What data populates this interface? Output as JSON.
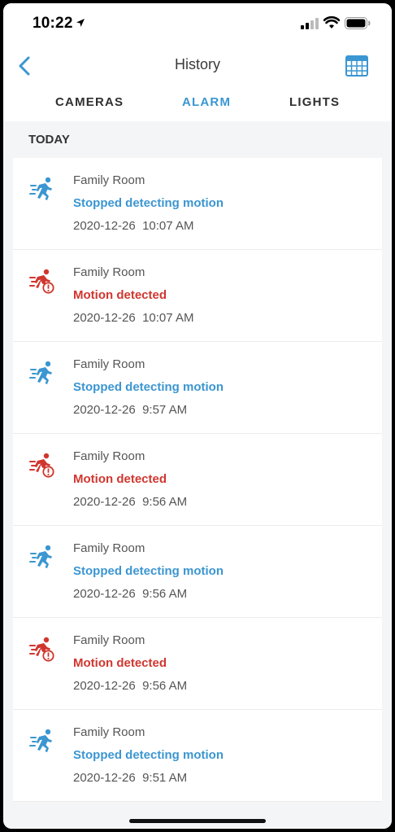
{
  "status_bar": {
    "time": "10:22"
  },
  "header": {
    "title": "History"
  },
  "tabs": [
    {
      "label": "CAMERAS",
      "active": false
    },
    {
      "label": "ALARM",
      "active": true
    },
    {
      "label": "LIGHTS",
      "active": false
    }
  ],
  "section": {
    "title": "TODAY"
  },
  "colors": {
    "accent_blue": "#3b96d1",
    "alert_red": "#d0362e"
  },
  "events": [
    {
      "device": "Family Room",
      "status": "Stopped detecting motion",
      "kind": "stopped",
      "icon": "motion-stopped-icon",
      "time": "2020-12-26  10:07 AM"
    },
    {
      "device": "Family Room",
      "status": "Motion detected",
      "kind": "motion",
      "icon": "motion-alert-icon",
      "time": "2020-12-26  10:07 AM"
    },
    {
      "device": "Family Room",
      "status": "Stopped detecting motion",
      "kind": "stopped",
      "icon": "motion-stopped-icon",
      "time": "2020-12-26  9:57 AM"
    },
    {
      "device": "Family Room",
      "status": "Motion detected",
      "kind": "motion",
      "icon": "motion-alert-icon",
      "time": "2020-12-26  9:56 AM"
    },
    {
      "device": "Family Room",
      "status": "Stopped detecting motion",
      "kind": "stopped",
      "icon": "motion-stopped-icon",
      "time": "2020-12-26  9:56 AM"
    },
    {
      "device": "Family Room",
      "status": "Motion detected",
      "kind": "motion",
      "icon": "motion-alert-icon",
      "time": "2020-12-26  9:56 AM"
    },
    {
      "device": "Family Room",
      "status": "Stopped detecting motion",
      "kind": "stopped",
      "icon": "motion-stopped-icon",
      "time": "2020-12-26  9:51 AM"
    }
  ]
}
